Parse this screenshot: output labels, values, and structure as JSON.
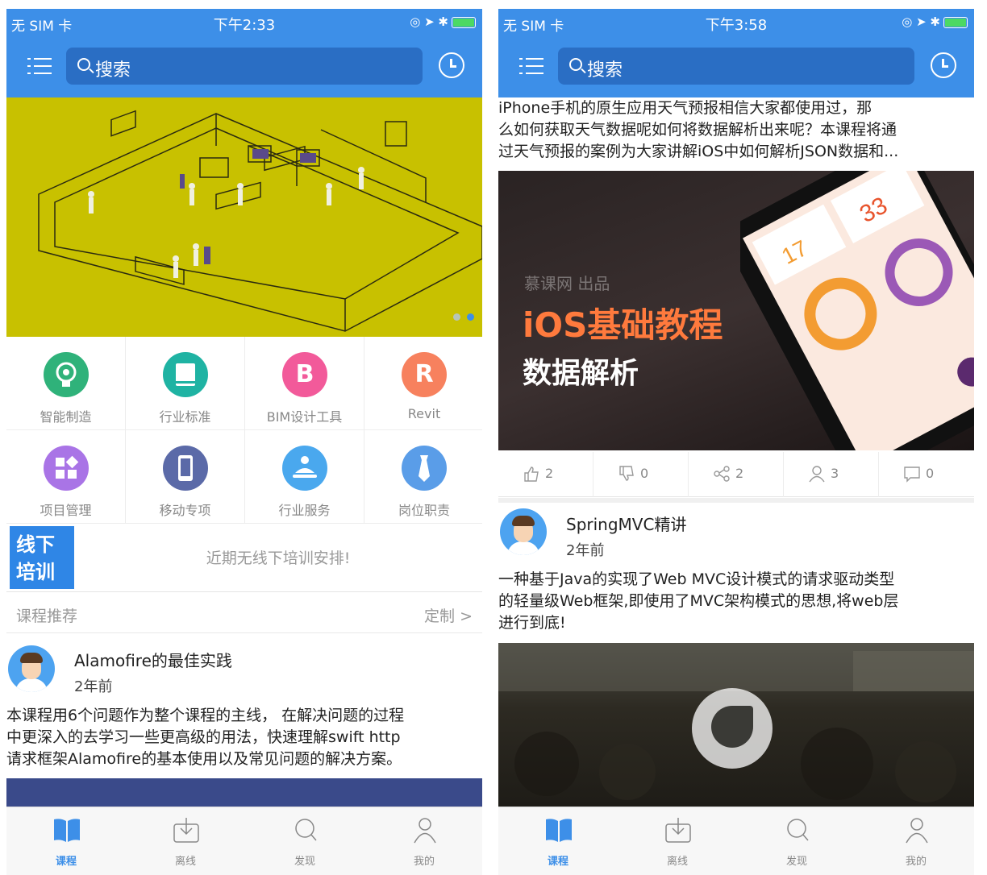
{
  "status_left": {
    "carrier": "无 SIM 卡",
    "time": "下午2:33"
  },
  "status_right": {
    "carrier": "无 SIM 卡",
    "time": "下午3:58"
  },
  "nav": {
    "search_placeholder": "搜索",
    "menu_icon": "list-icon",
    "history_icon": "clock-icon"
  },
  "banner": {
    "page_count": 2,
    "active_page": 2
  },
  "categories": [
    {
      "label": "智能制造",
      "icon": "lightbulb-icon",
      "color": "#2fb27a",
      "glyph": "💡"
    },
    {
      "label": "行业标准",
      "icon": "book-icon",
      "color": "#1fb3a3",
      "glyph": "▤"
    },
    {
      "label": "BIM设计工具",
      "icon": "letter-b-icon",
      "color": "#f25a9a",
      "glyph": "B"
    },
    {
      "label": "Revit",
      "icon": "letter-r-icon",
      "color": "#f7815e",
      "glyph": "R"
    },
    {
      "label": "项目管理",
      "icon": "grid-icon",
      "color": "#a974e6",
      "glyph": "▦"
    },
    {
      "label": "移动专项",
      "icon": "phone-icon",
      "color": "#5b6aa8",
      "glyph": "▯"
    },
    {
      "label": "行业服务",
      "icon": "service-icon",
      "color": "#4aa8ee",
      "glyph": "♨"
    },
    {
      "label": "岗位职责",
      "icon": "tie-icon",
      "color": "#5a9de8",
      "glyph": "▼"
    }
  ],
  "offline": {
    "badge_line1": "线下",
    "badge_line2": "培训",
    "message": "近期无线下培训安排!"
  },
  "recommend": {
    "title": "课程推荐",
    "customize": "定制 >"
  },
  "left_course": {
    "title": "Alamofire的最佳实践",
    "time": "2年前",
    "desc_line1": "本课程用6个问题作为整个课程的主线， 在解决问题的过程",
    "desc_line2": "中更深入的去学习一些更高级的用法，快速理解swift http",
    "desc_line3": "请求框架Alamofire的基本使用以及常见问题的解决方案。"
  },
  "right_top_desc": {
    "line1": "iPhone手机的原生应用天气预报相信大家都使用过，那",
    "line2": "么如何获取天气数据呢如何将数据解析出来呢？本课程将通",
    "line3": "过天气预报的案例为大家讲解iOS中如何解析JSON数据和..."
  },
  "ios_banner": {
    "brand": "慕课网 出品",
    "title": "iOS基础教程",
    "subtitle": "数据解析"
  },
  "stats": [
    {
      "icon": "thumbs-up-icon",
      "count": "2"
    },
    {
      "icon": "thumbs-down-icon",
      "count": "0"
    },
    {
      "icon": "share-icon",
      "count": "2"
    },
    {
      "icon": "user-icon",
      "count": "3"
    },
    {
      "icon": "comment-icon",
      "count": "0"
    }
  ],
  "right_course": {
    "title": "SpringMVC精讲",
    "time": "2年前",
    "desc_line1": "一种基于Java的实现了Web MVC设计模式的请求驱动类型",
    "desc_line2": "的轻量级Web框架,即使用了MVC架构模式的思想,将web层",
    "desc_line3": "进行到底!"
  },
  "tabs": [
    {
      "label": "课程",
      "icon": "book-open-icon",
      "active": true
    },
    {
      "label": "离线",
      "icon": "download-icon",
      "active": false
    },
    {
      "label": "发现",
      "icon": "search-icon",
      "active": false
    },
    {
      "label": "我的",
      "icon": "person-icon",
      "active": false
    }
  ],
  "colors": {
    "primary": "#3d8fe8",
    "banner_bg": "#c8c100",
    "tab_active": "#3d8fe8"
  }
}
